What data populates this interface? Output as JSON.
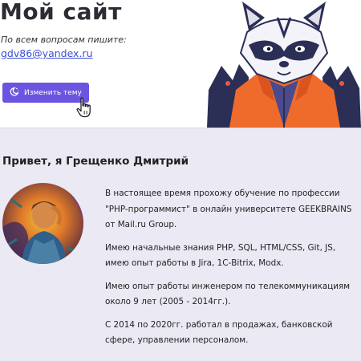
{
  "header": {
    "site_title": "Мой сайт",
    "contact_note": "По всем вопросам пишите:",
    "contact_email": "gdv86@yandex.ru",
    "theme_button_label": "Изменить тему",
    "theme_icon": "moon-stars-icon",
    "cursor_icon": "hand-pointer-icon",
    "mascot_icon": "raccoon-mascot-icon"
  },
  "colors": {
    "accent": "#6b55e0",
    "link": "#3a4fd6",
    "page_bg": "#ebe9f3",
    "header_bg": "#ffffff"
  },
  "main": {
    "greeting": "Привет, я Грещенко Дмитрий",
    "avatar_icon": "profile-photo",
    "bio": [
      "В настоящее время прохожу обучение по профессии \"PHP-программист\" в онлайн университете GEEKBRAINS от Mail.ru Group.",
      "Имею начальные знания PHP, SQL, HTML/CSS, Git, JS, имею опыт работы в Jira, 1С-Bitrix, Modx.",
      "Имею опыт работы инженером по телекоммуникациям около 9 лет (2005 - 2014гг.).",
      "С 2014 по 2020гг. работал в продажах, банковской сфере, управлении персоналом."
    ]
  }
}
